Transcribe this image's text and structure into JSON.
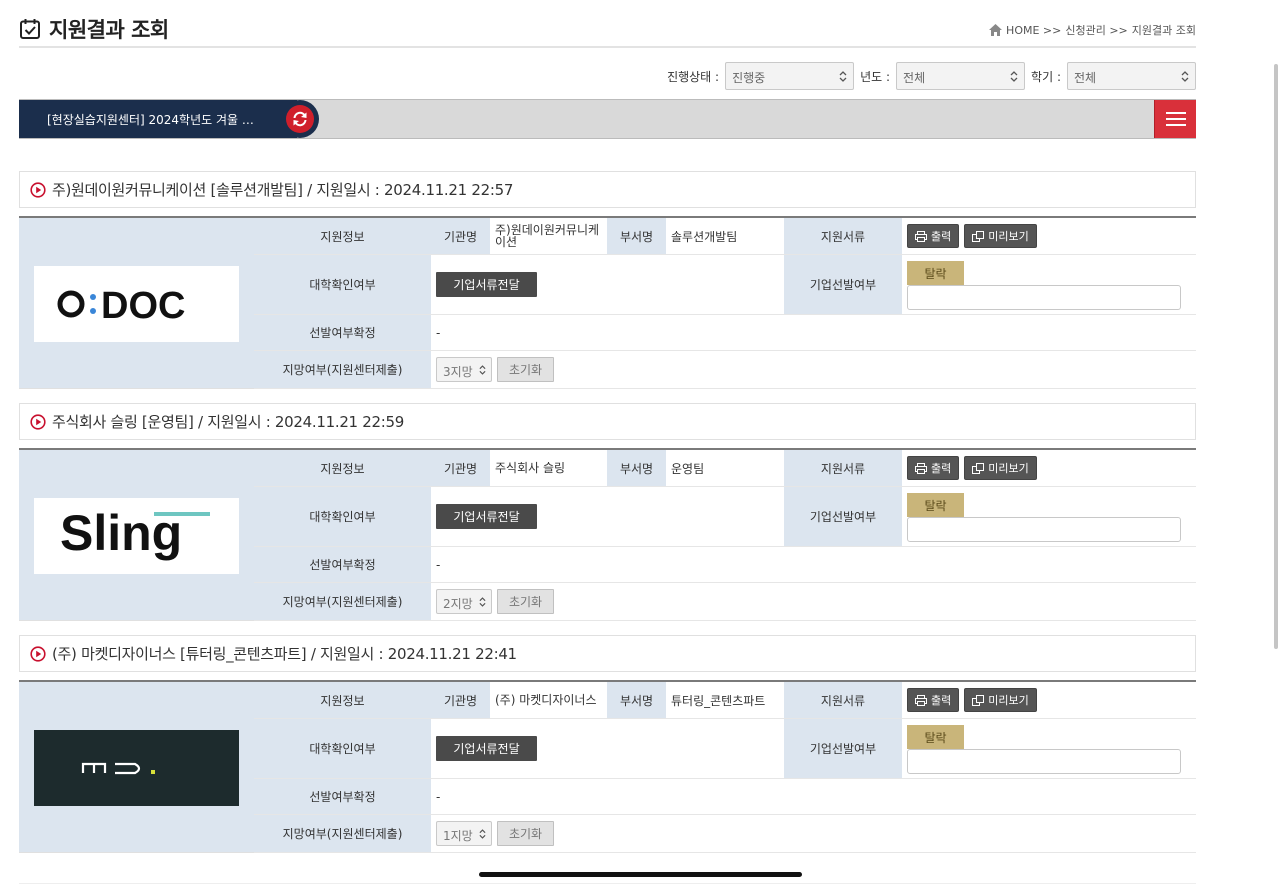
{
  "header": {
    "title": "지원결과 조회",
    "breadcrumb": [
      "HOME >>",
      "신청관리 >>",
      "지원결과 조회"
    ]
  },
  "filters": [
    {
      "label": "진행상태 :",
      "value": "진행중"
    },
    {
      "label": "년도 :",
      "value": "전체"
    },
    {
      "label": "학기 :",
      "value": "전체"
    }
  ],
  "app_bar": {
    "tab_label": "[현장실습지원센터] 2024학년도 겨울 …",
    "refresh_icon": "refresh-icon",
    "menu_icon": "hamburger-menu-icon"
  },
  "colors": {
    "navy": "#1b2e4c",
    "red": "#d01f2b",
    "label_bg": "#dce5ef",
    "fail_badge": "#c9b57a"
  },
  "applications": [
    {
      "heading": "주)원데이원커뮤니케이션 [솔루션개발팀] / 지원일시 : 2024.11.21 22:57",
      "logo_text": "O:DOC",
      "labels": {
        "info": "지원정보",
        "org": "기관명",
        "dept": "부서명",
        "docs": "지원서류",
        "univ": "대학확인여부",
        "corp_select": "기업선발여부",
        "confirm": "선발여부확정",
        "pref": "지망여부(지원센터제출)"
      },
      "org": "주)원데이원커뮤니케이션",
      "dept": "솔루션개발팀",
      "print_label": "출력",
      "preview_label": "미리보기",
      "transfer_label": "기업서류전달",
      "result_badge": "탈락",
      "result_input": "",
      "confirm_value": "-",
      "preference": "3지망",
      "reset_label": "초기화"
    },
    {
      "heading": "주식회사 슬링 [운영팀] / 지원일시 : 2024.11.21 22:59",
      "logo_text": "Sling",
      "labels": {
        "info": "지원정보",
        "org": "기관명",
        "dept": "부서명",
        "docs": "지원서류",
        "univ": "대학확인여부",
        "corp_select": "기업선발여부",
        "confirm": "선발여부확정",
        "pref": "지망여부(지원센터제출)"
      },
      "org": "주식회사 슬링",
      "dept": "운영팀",
      "print_label": "출력",
      "preview_label": "미리보기",
      "transfer_label": "기업서류전달",
      "result_badge": "탈락",
      "result_input": "",
      "confirm_value": "-",
      "preference": "2지망",
      "reset_label": "초기화"
    },
    {
      "heading": "(주) 마켓디자이너스 [튜터링_콘텐츠파트] / 지원일시 : 2024.11.21 22:41",
      "logo_text": "MD.",
      "labels": {
        "info": "지원정보",
        "org": "기관명",
        "dept": "부서명",
        "docs": "지원서류",
        "univ": "대학확인여부",
        "corp_select": "기업선발여부",
        "confirm": "선발여부확정",
        "pref": "지망여부(지원센터제출)"
      },
      "org": "(주) 마켓디자이너스",
      "dept": "튜터링_콘텐츠파트",
      "print_label": "출력",
      "preview_label": "미리보기",
      "transfer_label": "기업서류전달",
      "result_badge": "탈락",
      "result_input": "",
      "confirm_value": "-",
      "preference": "1지망",
      "reset_label": "초기화"
    }
  ]
}
